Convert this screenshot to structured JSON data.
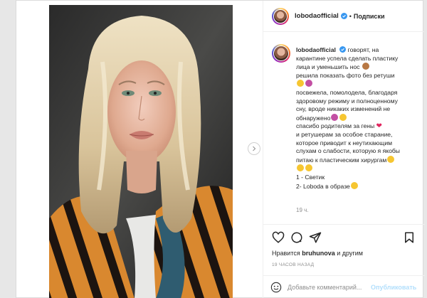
{
  "post": {
    "username": "lobodaofficial",
    "separator": "•",
    "follow_label": "Подписки",
    "caption_lines": [
      "говорят, на",
      "карантине успела сделать пластику",
      "лица и уменьшить нос",
      "решила показать фото без ретуши",
      "",
      "посвежела, помолодела, благодаря",
      "здоровому режиму и полноценному",
      "сну, вроде никаких изменений не",
      "обнаружено",
      "спасибо родителям за гены",
      "и ретушерам за особое старание,",
      "которое приводит к неутихающим",
      "слухам о слабости, которую я якобы",
      "питаю к пластическим хирургам",
      "",
      "1 - Светик",
      "2- Loboda в образе"
    ],
    "comment_time": "19 ч.",
    "likes_prefix": "Нравится",
    "likes_user": "bruhunova",
    "likes_suffix": "и другим",
    "posted_ago": "19 ЧАСОВ НАЗАД",
    "comment_placeholder": "Добавьте комментарий...",
    "publish_label": "Опубликовать"
  },
  "icons": {
    "verified": "verified-badge-icon",
    "like": "heart-icon",
    "comment": "comment-icon",
    "share": "share-icon",
    "save": "bookmark-icon",
    "next": "chevron-right-icon",
    "emoji": "smiley-icon"
  },
  "colors": {
    "verified_blue": "#3897f0",
    "muted": "#8e8e8e",
    "publish_disabled": "#b2dffc"
  }
}
